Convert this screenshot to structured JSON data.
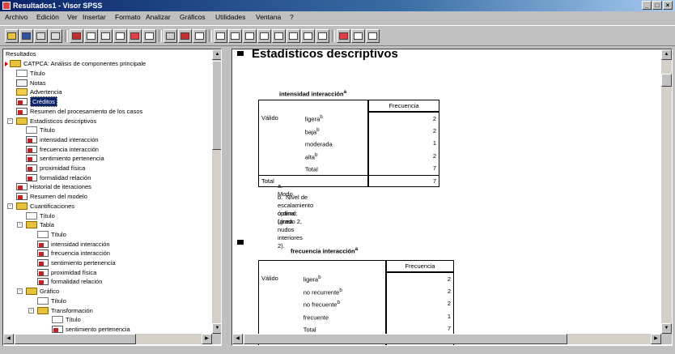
{
  "window": {
    "title": "Resultados1 - Visor SPSS",
    "buttons": [
      "_",
      "□",
      "×"
    ]
  },
  "menu": [
    "Archivo",
    "Edición",
    "Ver",
    "Insertar",
    "Formato",
    "Analizar",
    "Gráficos",
    "Utilidades",
    "Ventana",
    "?"
  ],
  "outline": {
    "root": "Resultados",
    "procedure": "CATPCA: Análisis de componentes principale",
    "items": [
      {
        "label": "Título",
        "level": 1,
        "icon": "text"
      },
      {
        "label": "Notas",
        "level": 1,
        "icon": "log"
      },
      {
        "label": "Advertencia",
        "level": 1,
        "icon": "warn"
      },
      {
        "label": "Créditos",
        "level": 1,
        "icon": "chart",
        "selected": true
      },
      {
        "label": "Resumen del procesamiento de los casos",
        "level": 1,
        "icon": "chart"
      },
      {
        "label": "Estadísticos descriptivos",
        "level": 1,
        "icon": "book",
        "expander": "-"
      },
      {
        "label": "Título",
        "level": 2,
        "icon": "text"
      },
      {
        "label": "intensidad interacción",
        "level": 2,
        "icon": "chart"
      },
      {
        "label": "frecuencia interacción",
        "level": 2,
        "icon": "chart"
      },
      {
        "label": "sentimiento pertenencia",
        "level": 2,
        "icon": "chart"
      },
      {
        "label": "proximidad física",
        "level": 2,
        "icon": "chart"
      },
      {
        "label": "formalidad relación",
        "level": 2,
        "icon": "chart"
      },
      {
        "label": "Historial de iteraciones",
        "level": 1,
        "icon": "chart"
      },
      {
        "label": "Resumen del modelo",
        "level": 1,
        "icon": "chart"
      },
      {
        "label": "Cuantificaciones",
        "level": 1,
        "icon": "book",
        "expander": "-"
      },
      {
        "label": "Título",
        "level": 2,
        "icon": "text"
      },
      {
        "label": "Tabla",
        "level": 2,
        "icon": "book",
        "expander": "-"
      },
      {
        "label": "Título",
        "level": 3,
        "icon": "text"
      },
      {
        "label": "intensidad interacción",
        "level": 3,
        "icon": "chart"
      },
      {
        "label": "frecuencia interacción",
        "level": 3,
        "icon": "chart"
      },
      {
        "label": "sentimiento pertenencia",
        "level": 3,
        "icon": "chart"
      },
      {
        "label": "proximidad física",
        "level": 3,
        "icon": "chart"
      },
      {
        "label": "formalidad relación",
        "level": 3,
        "icon": "chart"
      },
      {
        "label": "Gráfico",
        "level": 2,
        "icon": "book",
        "expander": "-"
      },
      {
        "label": "Título",
        "level": 3,
        "icon": "text"
      },
      {
        "label": "Transformación",
        "level": 3,
        "icon": "book",
        "expander": "-"
      },
      {
        "label": "Título",
        "level": 4,
        "icon": "text"
      },
      {
        "label": "sentimiento pertenencia",
        "level": 4,
        "icon": "chart"
      }
    ]
  },
  "content": {
    "heading": "Estadísticos descriptivos",
    "table1": {
      "title": "intensidad interacción",
      "title_sup": "a",
      "header": "Frecuencia",
      "group": "Válido",
      "rows": [
        {
          "cat": "ligera",
          "sup": "b",
          "val": "2"
        },
        {
          "cat": "baja",
          "sup": "b",
          "val": "2"
        },
        {
          "cat": "moderada",
          "sup": "",
          "val": "1"
        },
        {
          "cat": "alta",
          "sup": "b",
          "val": "2"
        },
        {
          "cat": "Total",
          "sup": "",
          "val": "7"
        }
      ],
      "total_label": "Total",
      "total_val": "7",
      "footnotes": [
        {
          "mark": "a.",
          "text": "Modo."
        },
        {
          "mark": "b.",
          "text": "Nivel de escalamiento óptimo: Línea"
        },
        {
          "mark": "",
          "text": "ordinal (grado 2, nudos interiores 2)."
        }
      ]
    },
    "table2": {
      "title": "frecuencia interacción",
      "title_sup": "a",
      "header": "Frecuencia",
      "group": "Válido",
      "rows": [
        {
          "cat": "ligera",
          "sup": "b",
          "val": "2"
        },
        {
          "cat": "no recurrente",
          "sup": "b",
          "val": "2"
        },
        {
          "cat": "no frecuente",
          "sup": "b",
          "val": "2"
        },
        {
          "cat": "frecuente",
          "sup": "",
          "val": "1"
        },
        {
          "cat": "Total",
          "sup": "",
          "val": "7"
        }
      ],
      "total_label": "Total",
      "total_val": "7"
    }
  }
}
